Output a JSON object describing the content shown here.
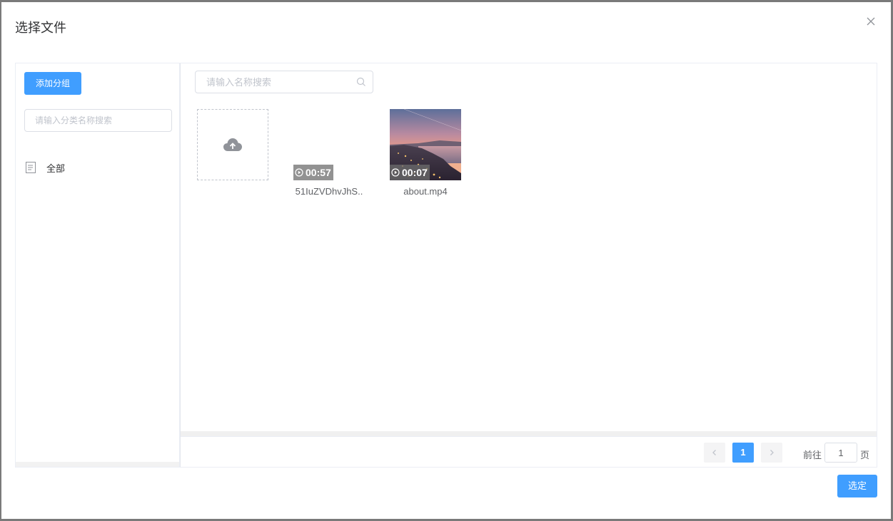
{
  "dialog": {
    "title": "选择文件",
    "confirm_label": "选定"
  },
  "sidebar": {
    "add_group_label": "添加分组",
    "search_placeholder": "请输入分类名称搜索",
    "categories": [
      {
        "label": "全部",
        "icon": "document-icon"
      }
    ]
  },
  "main": {
    "search_placeholder": "请输入名称搜索",
    "upload_icon": "cloud-upload-icon",
    "files": [
      {
        "name": "51IuZVDhvJhS..",
        "duration": "00:57",
        "thumbnail": "blank"
      },
      {
        "name": "about.mp4",
        "duration": "00:07",
        "thumbnail": "coastal-city-sunset"
      }
    ]
  },
  "pagination": {
    "current_page": "1",
    "goto_label": "前往",
    "goto_value": "1",
    "page_unit": "页"
  },
  "colors": {
    "primary": "#409eff",
    "text": "#606266",
    "border": "#dcdfe6"
  }
}
